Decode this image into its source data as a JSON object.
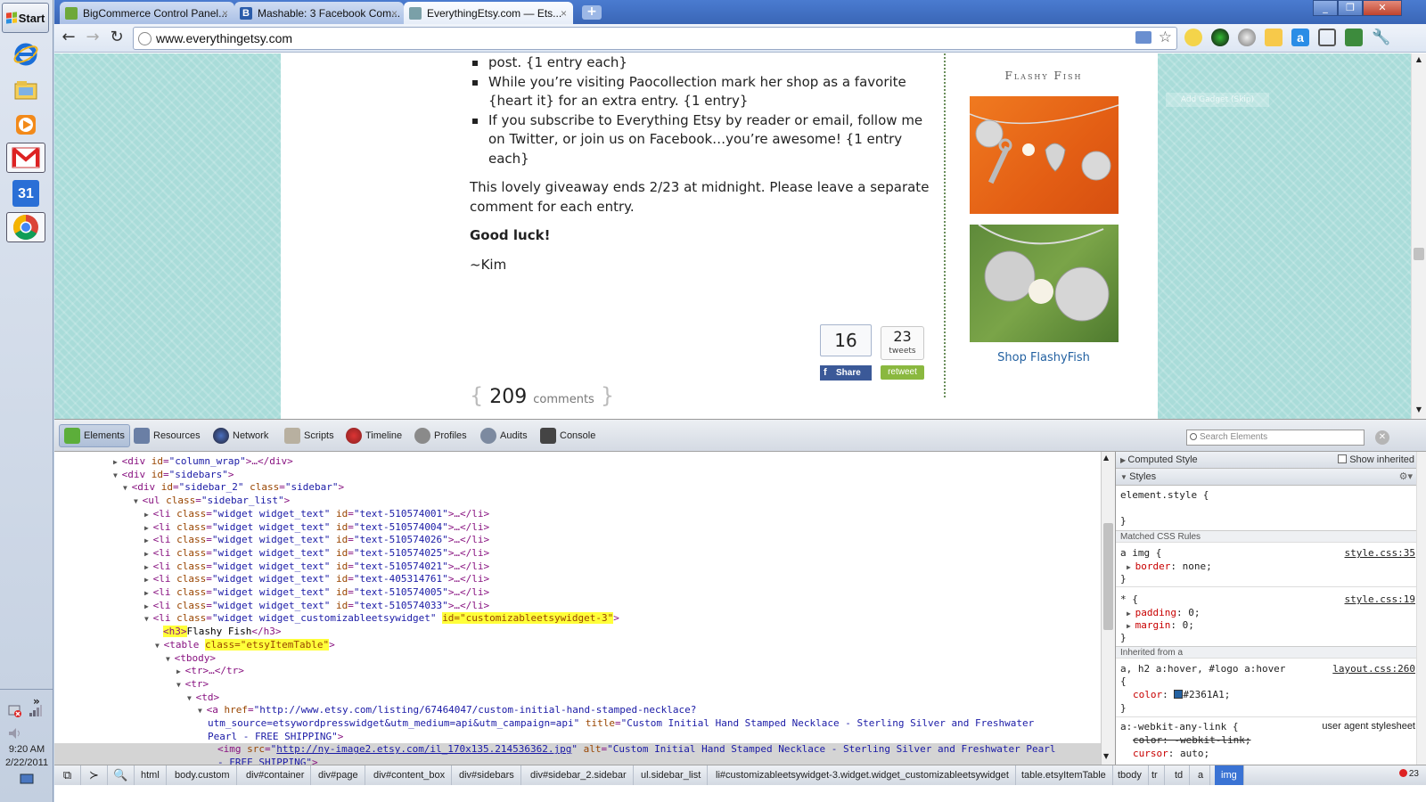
{
  "taskbar": {
    "start_label": "Start",
    "apps": [
      "internet-explorer",
      "file-explorer",
      "media-player",
      "gmail",
      "google-calendar",
      "google-chrome"
    ],
    "calendar_day": "31",
    "clock_time": "9:20 AM",
    "clock_date": "2/22/2011",
    "tray_arrow": "»"
  },
  "browser": {
    "tabs": [
      {
        "label": "BigCommerce Control Panel...",
        "active": false
      },
      {
        "label": "Mashable: 3 Facebook Com...",
        "active": false
      },
      {
        "label": "EverythingEtsy.com — Ets...",
        "active": true
      }
    ],
    "tab_close_glyph": "×",
    "new_tab_glyph": "+",
    "url": "www.everythingetsy.com"
  },
  "page": {
    "bullets": [
      "post. {1 entry each}",
      "While you’re visiting Paocollection mark her shop as a favorite {heart it} for an extra entry. {1 entry}",
      "If you subscribe to Everything Etsy by reader or email, follow me on Twitter, or join us on Facebook…you’re awesome!  {1 entry each}"
    ],
    "giveaway_text": "This lovely giveaway ends 2/23 at midnight.  Please leave a separate comment for each entry.",
    "good_luck": "Good luck!",
    "signature": "~Kim",
    "fb_count": "16",
    "fb_share_label": "Share",
    "tweet_count": "23",
    "tweet_label": "tweets",
    "retweet_label": "retweet",
    "comments_count": "209",
    "comments_label": "comments",
    "widget_title": "Flashy Fish",
    "shop_link": "Shop FlashyFish",
    "ghost_button": "Add Gadget (Skip)"
  },
  "devtools": {
    "tabs": [
      "Elements",
      "Resources",
      "Network",
      "Scripts",
      "Timeline",
      "Profiles",
      "Audits",
      "Console"
    ],
    "active_tab": "Elements",
    "search_placeholder": "Search Elements",
    "dom_lines": {
      "l01": {
        "open": "<div ",
        "a1": "id",
        "v1": "\"column_wrap\"",
        "close": ">…</div>"
      },
      "l02": {
        "open": "<div ",
        "a1": "id",
        "v1": "\"sidebars\"",
        "close": ">"
      },
      "l03": {
        "open": "<div ",
        "a1": "id",
        "v1": "\"sidebar_2\"",
        "a2": "class",
        "v2": "\"sidebar\"",
        "close": ">"
      },
      "l04": {
        "open": "<ul ",
        "a1": "class",
        "v1": "\"sidebar_list\"",
        "close": ">"
      },
      "li_items": [
        "\"text-510574001\"",
        "\"text-510574004\"",
        "\"text-510574026\"",
        "\"text-510574025\"",
        "\"text-510574021\"",
        "\"text-405314761\"",
        "\"text-510574005\"",
        "\"text-510574033\""
      ],
      "li_open": "<li ",
      "li_class_attr": "class",
      "li_class_val": "\"widget widget_text\"",
      "li_id_attr": "id",
      "li_close": ">…</li>",
      "l13": {
        "open": "<li ",
        "a1": "class",
        "v1": "\"widget widget_customizableetsywidget\"",
        "hl": "id=\"customizableetsywidget-3\"",
        "close": ">"
      },
      "l14": {
        "hl": "<h3>",
        "text": "Flashy Fish",
        "close": "</h3>"
      },
      "l15": {
        "open": "<table ",
        "hl": "class=\"etsyItemTable\"",
        "close": ">"
      },
      "l16": {
        "open": "<tbody>"
      },
      "l17": {
        "open": "<tr>…</tr>"
      },
      "l18": {
        "open": "<tr>"
      },
      "l19": {
        "open": "<td>"
      },
      "l20": {
        "open": "<a ",
        "a1": "href",
        "v1": "\"http://www.etsy.com/listing/67464047/custom-initial-hand-stamped-necklace?"
      },
      "l21": {
        "v1": "utm_source=etsywordpresswidget&utm_medium=api&utm_campaign=api\"",
        "a2": "title",
        "v2": "\"Custom Initial Hand Stamped Necklace - Sterling Silver and Freshwater"
      },
      "l22": {
        "v1": "Pearl - FREE SHIPPING\"",
        "close": ">"
      },
      "l23": {
        "open": "<img ",
        "a1": "src",
        "v1": "\"",
        "link": "http://ny-image2.etsy.com/il_170x135.214536362.jpg",
        "v1b": "\"",
        "a2": "alt",
        "v2": "\"Custom Initial Hand Stamped Necklace - Sterling Silver and Freshwater Pearl"
      },
      "l24": {
        "v1": "- FREE SHIPPING\"",
        "close": ">"
      }
    },
    "styles": {
      "computed_label": "Computed Style",
      "show_inherited": "Show inherited",
      "styles_label": "Styles",
      "element_style": "element.style {",
      "brace_close": "}",
      "matched_label": "Matched CSS Rules",
      "rule1_selector": "a img {",
      "rule1_prop": "border",
      "rule1_val": "none;",
      "rule1_src": "style.css:35",
      "rule2_selector": "* {",
      "rule2_prop1": "padding",
      "rule2_val1": "0;",
      "rule2_prop2": "margin",
      "rule2_val2": "0;",
      "rule2_src": "style.css:19",
      "inherited_label": "Inherited from a",
      "rule3_selector": "a, h2 a:hover, #logo a:hover",
      "rule3_src": "layout.css:260",
      "rule3_open": "{",
      "rule3_prop": "color",
      "rule3_val": "#2361A1;",
      "rule4_selector": "a:-webkit-any-link {",
      "rule4_src": "user agent stylesheet",
      "rule4_prop1": "color: -webkit-link;",
      "rule4_prop2": "cursor",
      "rule4_val2": "auto;"
    },
    "breadcrumbs": [
      "html",
      "body.custom",
      "div#container",
      "div#page",
      "div#content_box",
      "div#sidebars",
      "div#sidebar_2.sidebar",
      "ul.sidebar_list",
      "li#customizableetsywidget-3.widget.widget_customizableetsywidget",
      "table.etsyItemTable",
      "tbody",
      "tr",
      "td",
      "a",
      "img"
    ],
    "error_count": "23"
  },
  "colors": {
    "link_blue": "#2361a1",
    "page_bg": "#a9dcd9",
    "fb_blue": "#3b5998",
    "retweet_green": "#8ab83f",
    "highlight_yellow": "#ffff3a"
  }
}
